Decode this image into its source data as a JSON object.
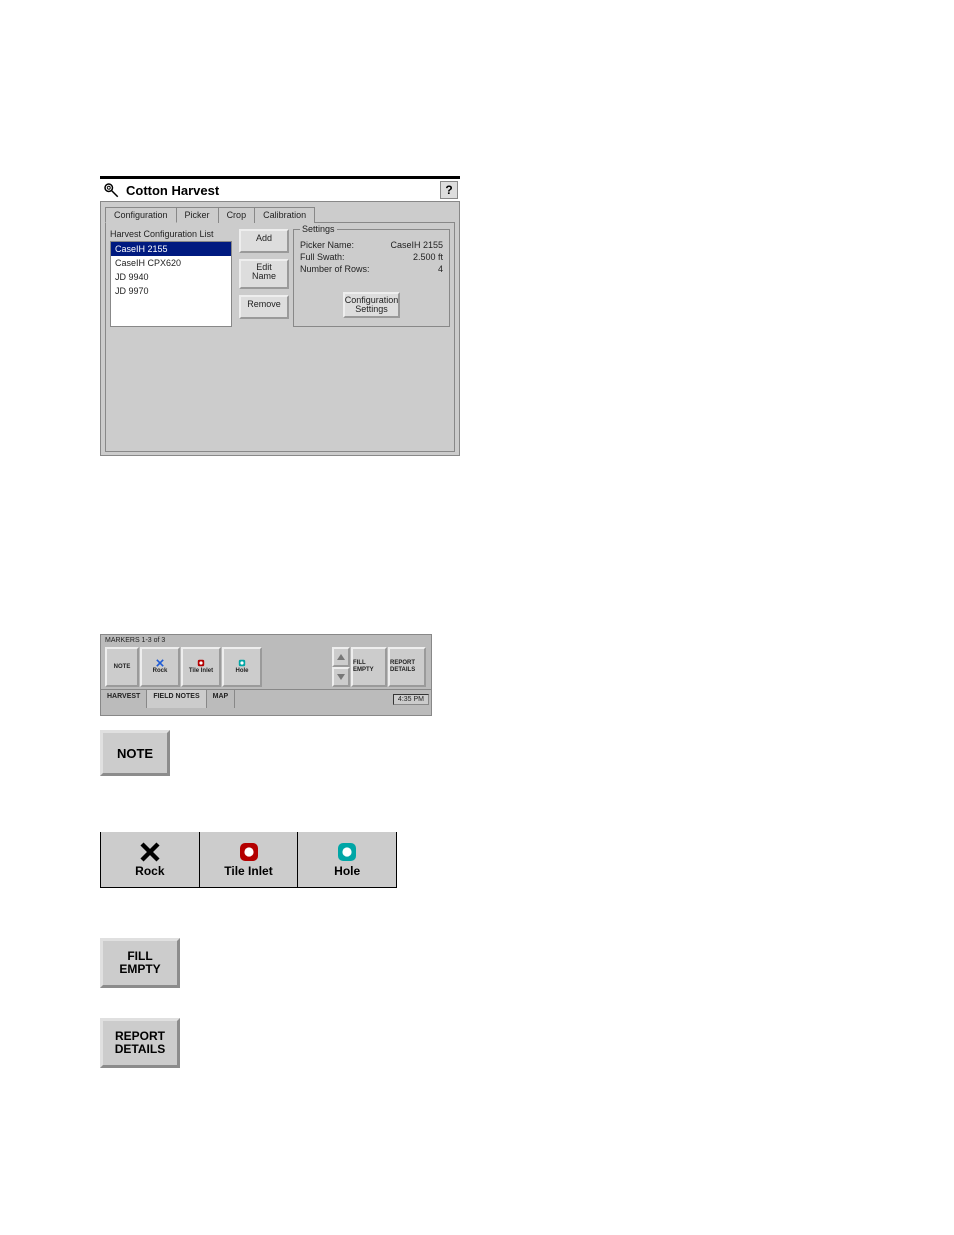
{
  "window": {
    "title": "Cotton Harvest",
    "help": "?",
    "tabs": {
      "configuration": "Configuration",
      "picker": "Picker",
      "crop": "Crop",
      "calibration": "Calibration"
    },
    "config": {
      "list_label": "Harvest Configuration List",
      "items": [
        "CaseIH 2155",
        "CaseIH CPX620",
        "JD 9940",
        "JD 9970"
      ],
      "selected_index": 0,
      "buttons": {
        "add": "Add",
        "edit_name": "Edit\nName",
        "remove": "Remove"
      }
    },
    "settings": {
      "legend": "Settings",
      "rows": [
        {
          "label": "Picker Name:",
          "value": "CaseIH 2155"
        },
        {
          "label": "Full Swath:",
          "value": "2.500 ft"
        },
        {
          "label": "Number of Rows:",
          "value": "4"
        }
      ],
      "config_settings_btn": "Configuration\nSettings"
    }
  },
  "bar": {
    "header": "MARKERS 1-3 of 3",
    "note": "NOTE",
    "markers": [
      "Rock",
      "Tile Inlet",
      "Hole"
    ],
    "fill_empty": "FILL EMPTY",
    "report_details": "REPORT DETAILS",
    "tabs": [
      "HARVEST",
      "FIELD NOTES",
      "MAP"
    ],
    "time": "4:35 PM"
  },
  "standalone": {
    "note": "NOTE",
    "markers": {
      "rock": "Rock",
      "tile_inlet": "Tile Inlet",
      "hole": "Hole"
    },
    "fill_empty": "FILL\nEMPTY",
    "report_details": "REPORT\nDETAILS"
  }
}
